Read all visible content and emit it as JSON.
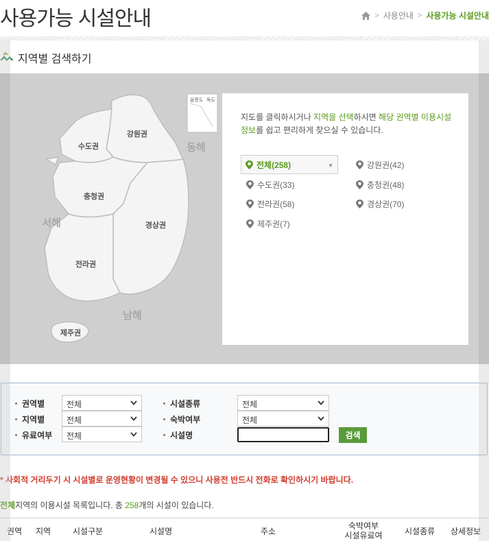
{
  "header": {
    "title": "사용가능 시설안내",
    "breadcrumb": [
      "사용안내",
      "사용가능 시설안내"
    ]
  },
  "section": {
    "heading": "지역별 검색하기"
  },
  "map": {
    "regions": [
      "강원권",
      "수도권",
      "충청권",
      "경상권",
      "전라권",
      "제주권"
    ],
    "seas": [
      "동해",
      "서해",
      "남해"
    ],
    "inset": [
      "울릉도",
      "독도"
    ]
  },
  "info": {
    "text_parts": [
      "지도를 클릭하시거나 ",
      "지역을 선택",
      "하시면 ",
      "해당 권역별 이용시설 정보",
      "를 쉽고 편리하게 찾으실 수 있습니다."
    ],
    "regions": [
      {
        "label": "전체(258)",
        "active": true
      },
      {
        "label": "강원권(42)"
      },
      {
        "label": "수도권(33)"
      },
      {
        "label": "충청권(48)"
      },
      {
        "label": "전라권(58)"
      },
      {
        "label": "경상권(70)"
      },
      {
        "label": "제주권(7)"
      }
    ]
  },
  "search": {
    "fields": {
      "region_area": {
        "label": "권역별",
        "value": "전체"
      },
      "region": {
        "label": "지역별",
        "value": "전체"
      },
      "paid": {
        "label": "유료여부",
        "value": "전체"
      },
      "facility_type": {
        "label": "시설종류",
        "value": "전체"
      },
      "lodging": {
        "label": "숙박여부",
        "value": "전체"
      },
      "facility_name": {
        "label": "시설명",
        "value": ""
      }
    },
    "button": "검색"
  },
  "notice": "* 사회적 거리두기 시 시설별로 운영현황이 변경될 수 있으니 사용전 반드시 전화로 확인하시기 바랍니다.",
  "summary": {
    "region": "전체",
    "text1": "지역의 이용시설 목록입니다. 총 ",
    "count": "258",
    "text2": "개의 시설이 있습니다."
  },
  "table": {
    "headers": [
      "권역",
      "지역",
      "시설구분",
      "시설명",
      "주소",
      "숙박여부",
      "시설유료여부",
      "시설종류",
      "상세정보"
    ]
  },
  "colors": {
    "accent": "#5a9a1e",
    "notice": "#d23b2c",
    "button": "#5a9a3a"
  }
}
